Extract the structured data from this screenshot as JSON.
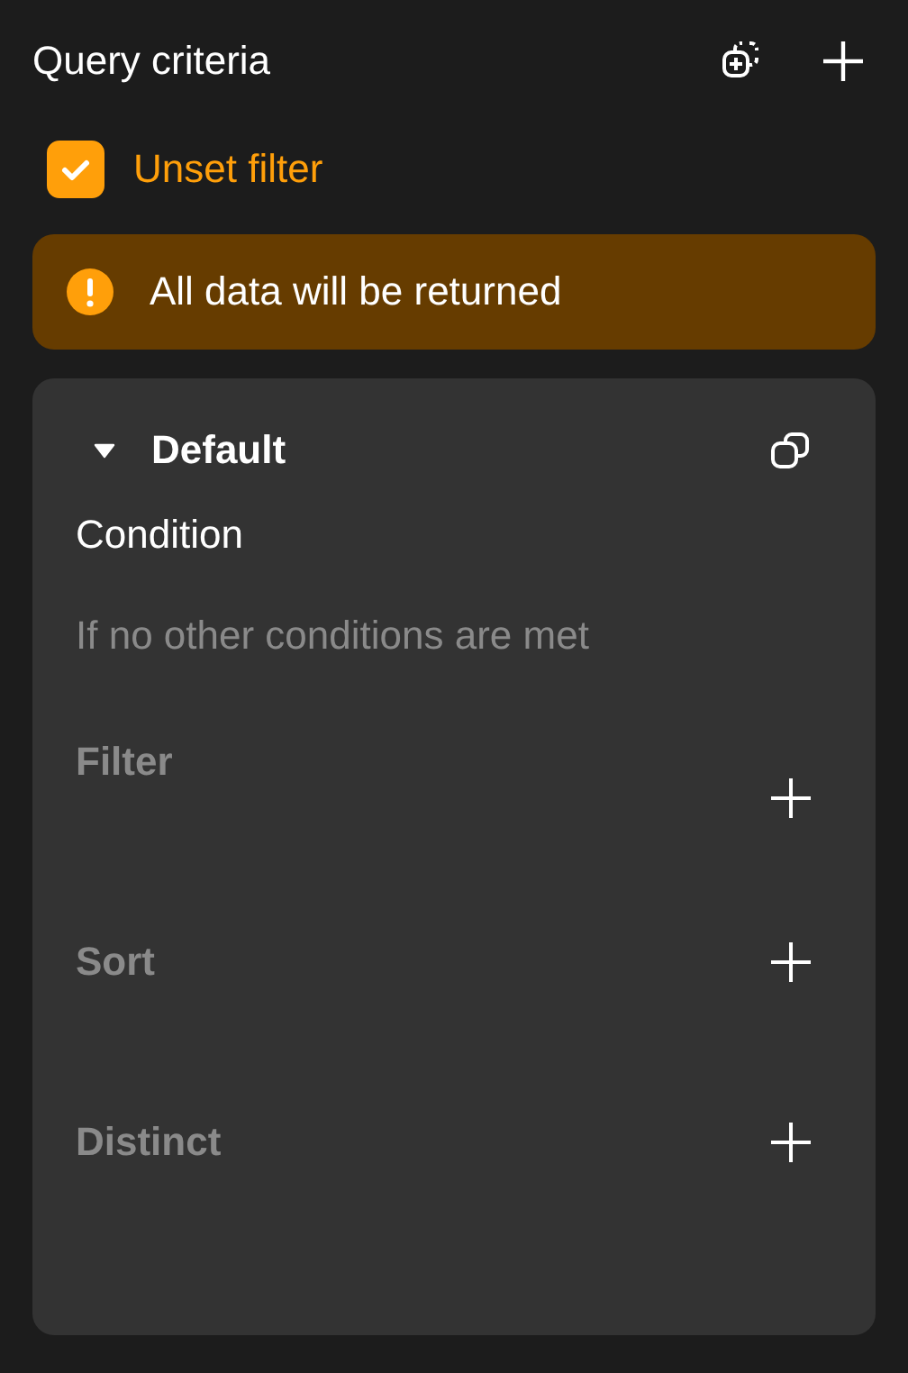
{
  "header": {
    "title": "Query criteria"
  },
  "unset_filter": {
    "label": "Unset filter",
    "checked": true
  },
  "alert": {
    "message": "All data will be returned"
  },
  "group": {
    "title": "Default",
    "expanded": true,
    "condition_label": "Condition",
    "condition_text": "If no other conditions are met",
    "sections": [
      {
        "label": "Filter"
      },
      {
        "label": "Sort"
      },
      {
        "label": "Distinct"
      }
    ]
  }
}
